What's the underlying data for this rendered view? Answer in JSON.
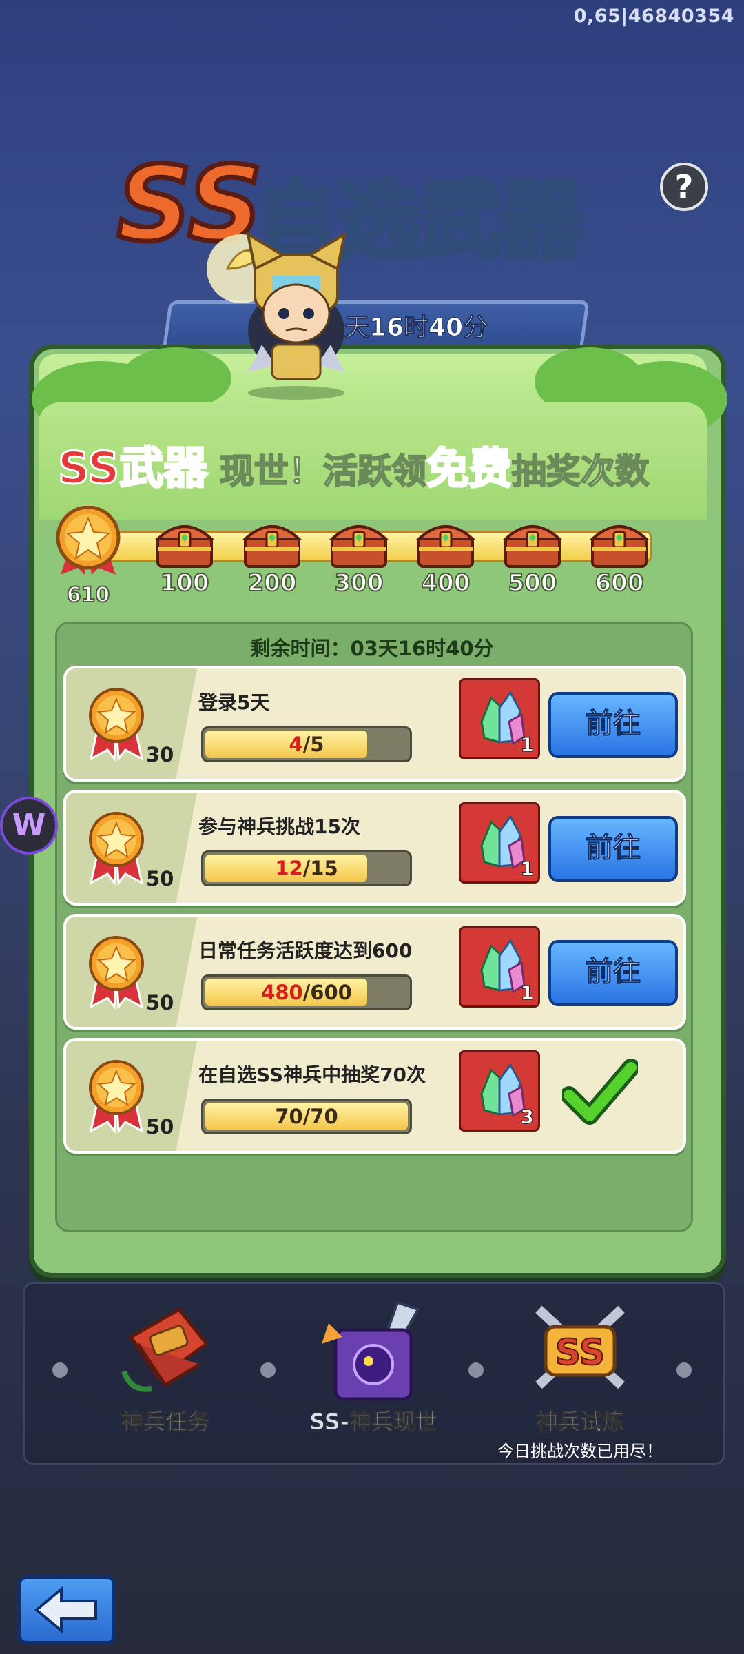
{
  "debug_id": "0,65|46840354",
  "title": {
    "ss": "SS",
    "main": "自选武器"
  },
  "help_label": "?",
  "timer_banner": "天16时40分",
  "headline": {
    "part1": "SS武器",
    "part2": " 现世！活跃领",
    "part3": "免费",
    "part4": "抽奖次数"
  },
  "points": {
    "current": "610",
    "milestones": [
      "100",
      "200",
      "300",
      "400",
      "500",
      "600"
    ]
  },
  "remaining": "剩余时间：03天16时40分",
  "tasks": [
    {
      "title": "登录5天",
      "points": "30",
      "current": "4",
      "total": "/5",
      "progress": 0.8,
      "reward_count": "1",
      "action": "前往"
    },
    {
      "title": "参与神兵挑战15次",
      "points": "50",
      "current": "12",
      "total": "/15",
      "progress": 0.8,
      "reward_count": "1",
      "action": "前往"
    },
    {
      "title": "日常任务活跃度达到600",
      "points": "50",
      "current": "480",
      "total": "/600",
      "progress": 0.8,
      "reward_count": "1",
      "action": "前往"
    },
    {
      "title": "在自选SS神兵中抽奖70次",
      "points": "50",
      "current": "70",
      "total": "/70",
      "progress": 1.0,
      "reward_count": "3",
      "action": "done"
    }
  ],
  "nav": [
    {
      "label": "神兵任务",
      "sub": ""
    },
    {
      "label": "SS-神兵现世",
      "sub": ""
    },
    {
      "label": "神兵试炼",
      "sub": "今日挑战次数已用尽！"
    }
  ],
  "side_icon": "W",
  "colors": {
    "panel": "#8ec67a",
    "button_blue": "#2a74e4",
    "reward_red": "#d33a36",
    "highlight_pink": "#e651c7"
  }
}
